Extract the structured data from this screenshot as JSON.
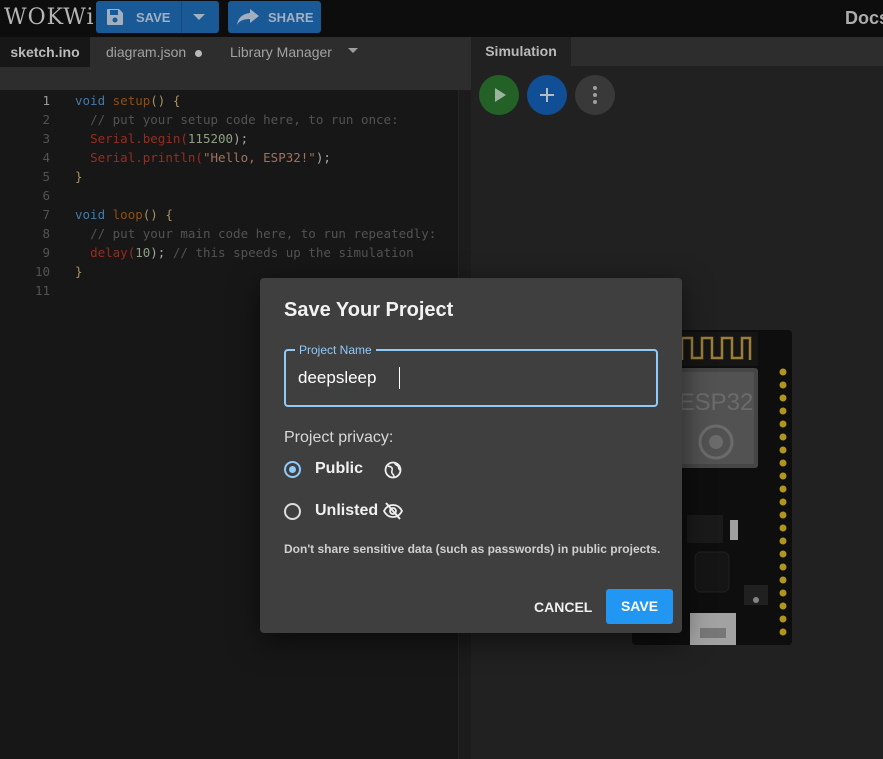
{
  "app": {
    "logo": "WOKWi",
    "docs_label": "Docs"
  },
  "toolbar": {
    "save_label": "SAVE",
    "share_label": "SHARE"
  },
  "editor_tabs": [
    {
      "label": "sketch.ino"
    },
    {
      "label": "diagram.json"
    },
    {
      "label": "Library Manager"
    }
  ],
  "simulation": {
    "tab_label": "Simulation",
    "board_label": "ESP32"
  },
  "code": {
    "lines": [
      {
        "n": "1"
      },
      {
        "n": "2"
      },
      {
        "n": "3"
      },
      {
        "n": "4"
      },
      {
        "n": "5"
      },
      {
        "n": "6"
      },
      {
        "n": "7"
      },
      {
        "n": "8"
      },
      {
        "n": "9"
      },
      {
        "n": "10"
      },
      {
        "n": "11"
      }
    ],
    "tokens": {
      "void1": "void",
      "setup": "setup",
      "paren1": "()",
      "brace_open1": "{",
      "comment_setup": "// put your setup code here, to run once:",
      "serial1": "Serial",
      "begin": ".begin(",
      "baud": "115200",
      "close1": ");",
      "serial2": "Serial",
      "println": ".println(",
      "hello": "\"Hello, ESP32!\"",
      "close2": ");",
      "brace_close1": "}",
      "void2": "void",
      "loop": "loop",
      "paren2": "()",
      "brace_open2": "{",
      "comment_loop": "// put your main code here, to run repeatedly:",
      "delay": "delay(",
      "delay_val": "10",
      "close3": ");",
      "comment_delay": "// this speeds up the simulation",
      "brace_close2": "}"
    }
  },
  "dialog": {
    "title": "Save Your Project",
    "field_label": "Project Name",
    "project_name": "deepsleep",
    "privacy_label": "Project privacy:",
    "options": [
      {
        "label": "Public",
        "selected": true,
        "icon": "globe-icon"
      },
      {
        "label": "Unlisted",
        "selected": false,
        "icon": "eye-off-icon"
      }
    ],
    "hint": "Don't share sensitive data (such as passwords) in public projects.",
    "cancel_label": "CANCEL",
    "save_label": "SAVE"
  },
  "colors": {
    "accent": "#2196f3",
    "toolbar_button": "#2172c1",
    "focus": "#90caf9",
    "play": "#2e7d32"
  }
}
